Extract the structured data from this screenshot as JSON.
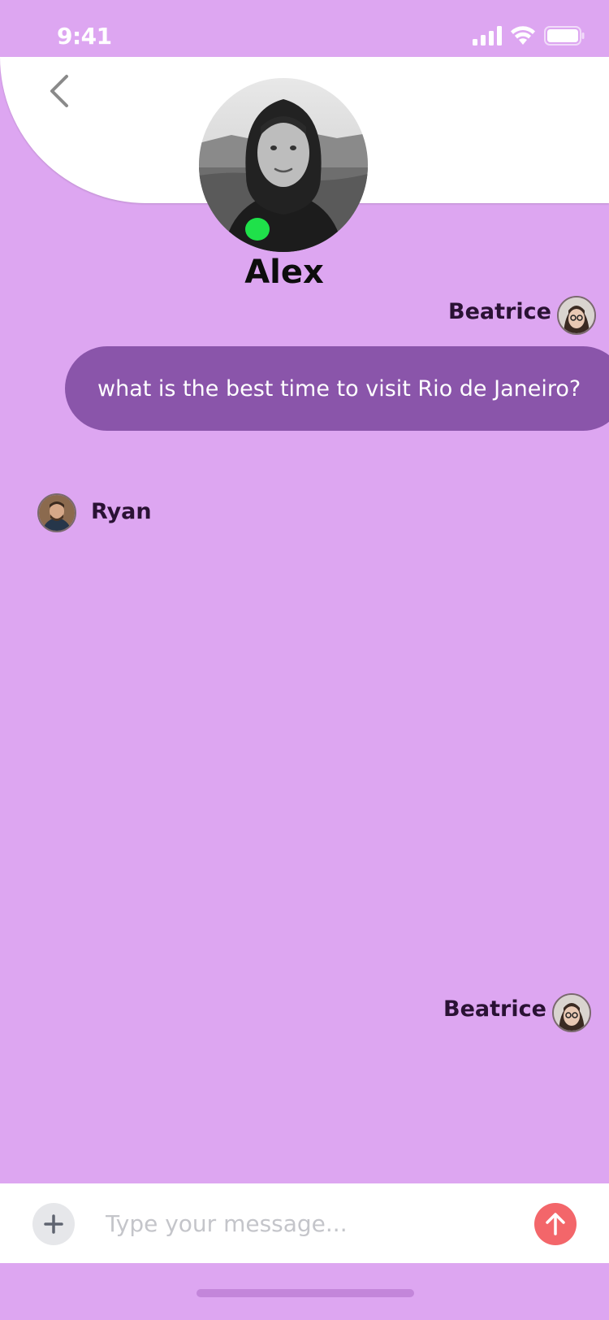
{
  "status_bar": {
    "time": "9:41",
    "icons": [
      "signal-icon",
      "wifi-icon",
      "battery-icon"
    ]
  },
  "header": {
    "back_icon": "chevron-left-icon",
    "contact_name": "Alex",
    "contact_status": "online",
    "status_color": "#1fe14a"
  },
  "messages": [
    {
      "sender": "Beatrice",
      "side": "right",
      "text": "what is the best time to visit Rio de Janeiro?"
    },
    {
      "sender": "Ryan",
      "side": "left",
      "text": ""
    },
    {
      "sender": "Beatrice",
      "side": "right",
      "text": ""
    }
  ],
  "composer": {
    "attach_icon": "plus-icon",
    "placeholder": "Type your message...",
    "send_icon": "arrow-up-icon"
  },
  "colors": {
    "background": "#dda6f1",
    "bubble": "#8a55aa",
    "send": "#f3666a"
  }
}
